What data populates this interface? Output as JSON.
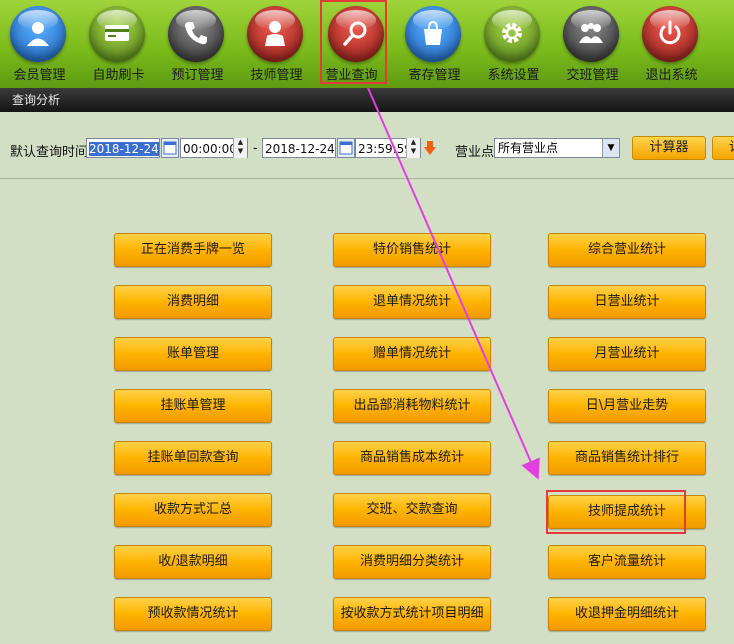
{
  "toolbar": {
    "items": [
      {
        "label": "会员管理",
        "icon": "member-icon",
        "color": "#2b7fd8"
      },
      {
        "label": "自助刷卡",
        "icon": "card-icon",
        "color": "#6aa020"
      },
      {
        "label": "预订管理",
        "icon": "phone-icon",
        "color": "#444444"
      },
      {
        "label": "技师管理",
        "icon": "technician-icon",
        "color": "#c0302a"
      },
      {
        "label": "营业查询",
        "icon": "search-icon",
        "color": "#c0302a"
      },
      {
        "label": "寄存管理",
        "icon": "bag-icon",
        "color": "#2b7fd8"
      },
      {
        "label": "系统设置",
        "icon": "gear-icon",
        "color": "#6aa020"
      },
      {
        "label": "交班管理",
        "icon": "handover-icon",
        "color": "#444444"
      },
      {
        "label": "退出系统",
        "icon": "power-icon",
        "color": "#c0302a"
      }
    ]
  },
  "titlebar": {
    "text": "查询分析"
  },
  "query": {
    "date_label": "默认查询时间",
    "start_date": "2018-12-24",
    "start_time": "00:00:00",
    "separator": "-",
    "end_date": "2018-12-24",
    "end_time": "23:59:59",
    "outlet_label": "营业点",
    "outlet_value": "所有营业点",
    "calc_label": "计算器",
    "extra_label": "计"
  },
  "buttons": {
    "col1": [
      "正在消费手牌一览",
      "消费明细",
      "账单管理",
      "挂账单管理",
      "挂账单回款查询",
      "收款方式汇总",
      "收/退款明细",
      "预收款情况统计"
    ],
    "col2": [
      "特价销售统计",
      "退单情况统计",
      "赠单情况统计",
      "出品部消耗物料统计",
      "商品销售成本统计",
      "交班、交款查询",
      "消费明细分类统计",
      "按收款方式统计项目明细"
    ],
    "col3": [
      "综合营业统计",
      "日营业统计",
      "月营业统计",
      "日\\月营业走势",
      "商品销售统计排行",
      "技师提成统计",
      "客户流量统计",
      "收退押金明细统计"
    ]
  },
  "colors": {
    "accent": "#ffb300",
    "highlight": "#e53a3a",
    "arrow": "#e040e0"
  }
}
